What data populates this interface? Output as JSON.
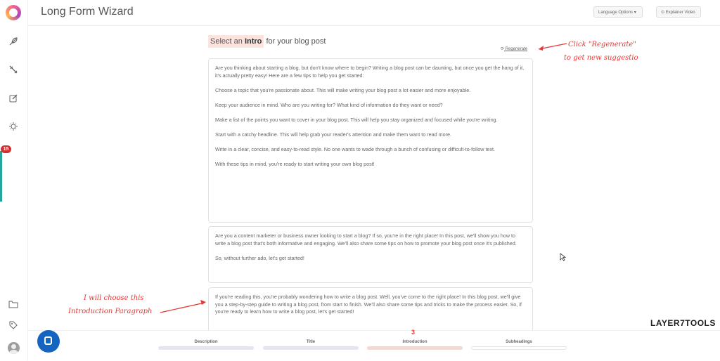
{
  "header": {
    "title": "Long Form Wizard",
    "language_button": "Language Options",
    "explainer_button": "Explainer Video"
  },
  "sidebar": {
    "badge_count": "15",
    "icons": [
      "feather-icon",
      "tools-icon",
      "edit-icon",
      "bulb-icon",
      "folder-icon",
      "tag-icon"
    ]
  },
  "main": {
    "title_prefix": "Select an",
    "title_bold": "Intro",
    "title_suffix": "for your blog post",
    "regenerate": "Regenerate",
    "cards": [
      {
        "paragraphs": [
          "Are you thinking about starting a blog, but don't know where to begin? Writing a blog post can be daunting, but once you get the hang of it, it's actually pretty easy! Here are a few tips to help you get started:",
          " Choose a topic that you're passionate about. This will make writing your blog post a lot easier and more enjoyable.",
          " Keep your audience in mind. Who are you writing for? What kind of information do they want or need?",
          " Make a list of the points you want to cover in your blog post. This will help you stay organized and focused while you're writing.",
          " Start with a catchy headline. This will help grab your reader's attention and make them want to read more.",
          " Write in a clear, concise, and easy-to-read style. No one wants to wade through a bunch of confusing or difficult-to-follow text.",
          "With these tips in mind, you're ready to start writing your own blog post!"
        ]
      },
      {
        "paragraphs": [
          "Are you a content marketer or business owner looking to start a blog? If so, you're in the right place! In this post, we'll show you how to write a blog post that's both informative and engaging. We'll also share some tips on how to promote your blog post once it's published.",
          "So, without further ado, let's get started!"
        ]
      },
      {
        "paragraphs": [
          "If you're reading this, you're probably wondering how to write a blog post. Well, you've come to the right place! In this blog post, we'll give you a step-by-step guide to writing a blog post, from start to finish. We'll also share some tips and tricks to make the process easier. So, if you're ready to learn how to write a blog post, let's get started!"
        ]
      }
    ]
  },
  "annotations": {
    "regen_line1": "Click \"Regenerate\"",
    "regen_line2": "to get new suggestio",
    "choose_line1": "I will choose this",
    "choose_line2": "Introduction Paragraph",
    "step_number": "3"
  },
  "steps": [
    {
      "label": "Description",
      "color": "#e3e4f4"
    },
    {
      "label": "Title",
      "color": "#e3e4f4"
    },
    {
      "label": "Introduction",
      "color": "#fbd5cf"
    },
    {
      "label": "Subheadings",
      "color": "#ffffff"
    }
  ],
  "brand": "LAYER7TOOLS",
  "colors": {
    "accent_red": "#e53935",
    "highlight": "#fde3de",
    "badge": "#d32f2f",
    "progress_green": "#26a69a",
    "chat_blue": "#1565c0"
  }
}
